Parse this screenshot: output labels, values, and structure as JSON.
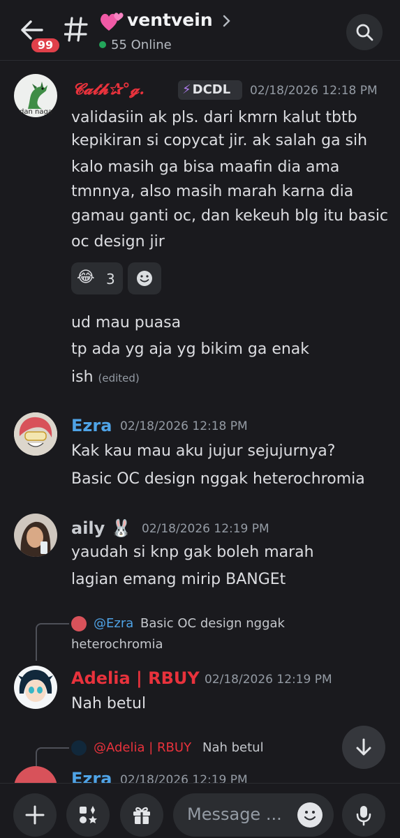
{
  "header": {
    "unread_badge": "99",
    "channel_name": "ventvein",
    "online_count": "55 Online"
  },
  "messages": [
    {
      "author": "𝓒𝓪𝓽𝓱✰°𝓰.",
      "author_color": "#e8323c",
      "avatar_label": "dan naga",
      "tag": "DCDL",
      "timestamp": "02/18/2026 12:18 PM",
      "lines": [
        "validasiin ak pls. dari kmrn kalut tbtb",
        "kepikiran si copycat jir. ak salah ga sih",
        "kalo masih ga bisa maafin dia ama",
        "tmnnya, also masih marah karna dia",
        "gamau ganti oc, dan kekeuh blg itu basic",
        "oc design jir"
      ],
      "reaction": {
        "emoji": "😂",
        "count": "3"
      },
      "followups": [
        "ud mau puasa",
        "tp ada yg aja yg bikim ga enak",
        "ish"
      ],
      "edited_label": "(edited)"
    },
    {
      "author": "Ezra",
      "author_color": "#4fa3e6",
      "timestamp": "02/18/2026 12:18 PM",
      "lines": [
        "Kak kau mau aku jujur sejujurnya?",
        "Basic OC design nggak heterochromia"
      ]
    },
    {
      "author": "aily 🐰",
      "author_color": "#c9ccd1",
      "timestamp": "02/18/2026 12:19 PM",
      "lines": [
        "yaudah si knp gak boleh marah",
        "lagian emang mirip BANGEt"
      ]
    },
    {
      "reply_to": "@Ezra",
      "reply_text_1": "Basic OC design nggak",
      "reply_text_2": "heterochromia",
      "author": "Adelia | RBUY",
      "author_color": "#e8323c",
      "timestamp": "02/18/2026 12:19 PM",
      "lines": [
        "Nah betul"
      ]
    },
    {
      "reply_to": "@Adelia | RBUY",
      "reply_text_1": "Nah betul",
      "author": "Ezra",
      "author_color": "#4fa3e6",
      "timestamp": "02/18/2026 12:19 PM"
    }
  ],
  "composer": {
    "placeholder": "Message ..."
  },
  "icons": {
    "back": "arrow-left-icon",
    "channel": "hash-icon",
    "search": "search-icon",
    "scroll_down": "arrow-down-icon",
    "add": "plus-icon",
    "apps": "apps-icon",
    "gift": "gift-icon",
    "emoji": "emoji-icon",
    "voice": "microphone-icon"
  }
}
